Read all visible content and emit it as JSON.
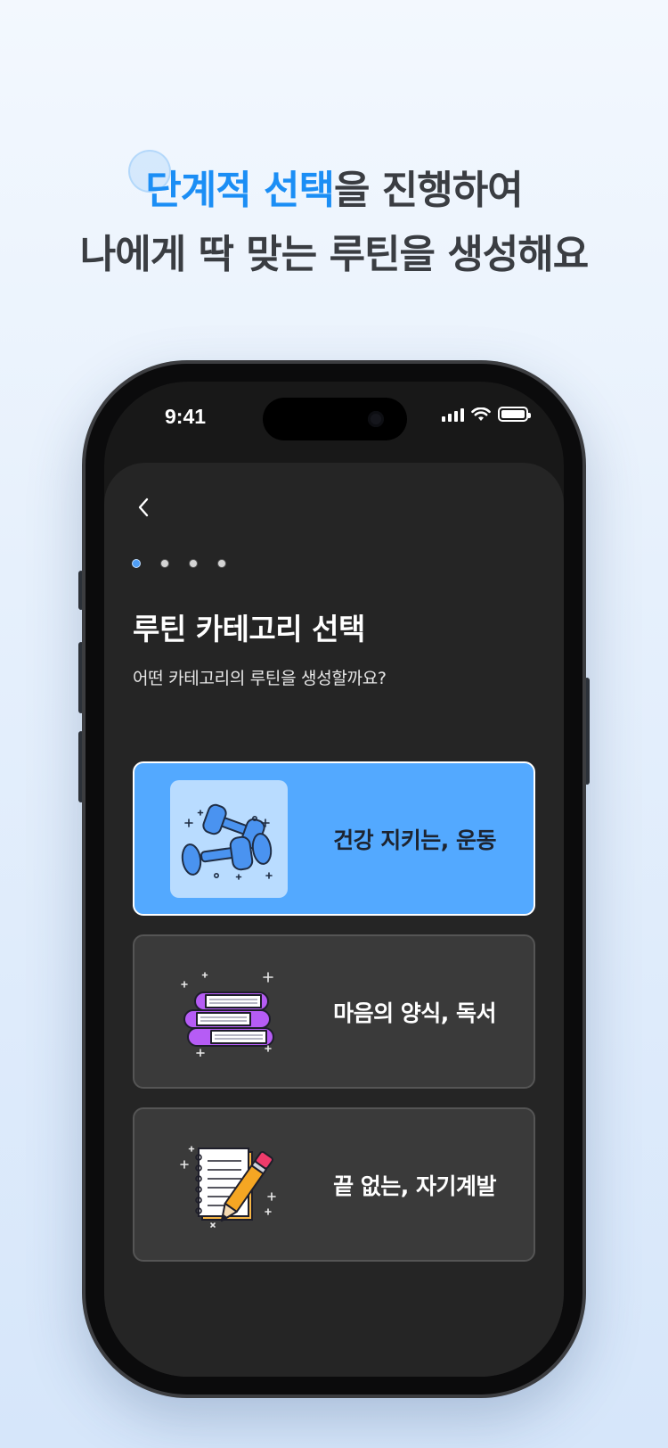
{
  "headline": {
    "line1_accent": "단계적 선택",
    "line1_rest": "을 진행하여",
    "line2": "나에게 딱 맞는 루틴을 생성해요"
  },
  "status_bar": {
    "time": "9:41"
  },
  "page": {
    "title": "루틴 카테고리 선택",
    "subtitle": "어떤 카테고리의 루틴을 생성할까요?",
    "steps": {
      "total": 4,
      "current": 1
    }
  },
  "categories": [
    {
      "label": "건강 지키는, 운동",
      "icon": "dumbbell-icon",
      "selected": true
    },
    {
      "label": "마음의 양식, 독서",
      "icon": "books-icon",
      "selected": false
    },
    {
      "label": "끝 없는, 자기계발",
      "icon": "notebook-pencil-icon",
      "selected": false
    }
  ],
  "colors": {
    "accent": "#1b8ef5",
    "selected_card": "#53a9ff",
    "sheet_background": "#252525",
    "card_background": "#3a3a3a"
  }
}
